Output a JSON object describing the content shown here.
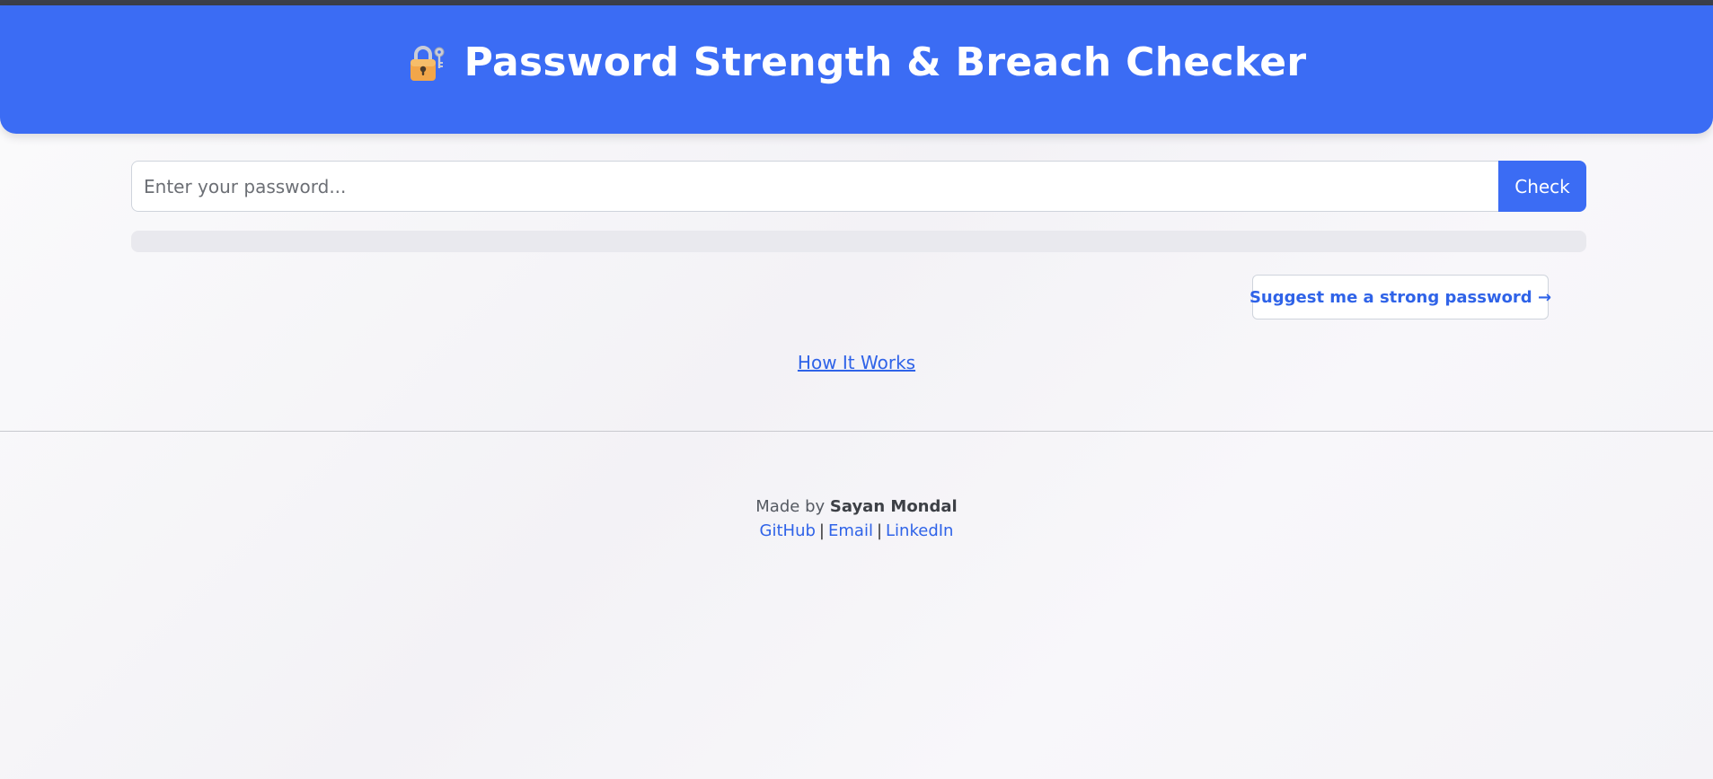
{
  "header": {
    "icon": "lock-with-key-icon",
    "title": "Password Strength & Breach Checker"
  },
  "password_form": {
    "placeholder": "Enter your password...",
    "value": "",
    "check_label": "Check"
  },
  "strength_meter": {
    "fill_percent": 0
  },
  "suggest": {
    "label": "Suggest me a strong password →"
  },
  "how_it_works": {
    "label": "How It Works"
  },
  "footer": {
    "made_by_prefix": "Made by",
    "author": "Sayan Mondal",
    "links": [
      "GitHub",
      "Email",
      "LinkedIn"
    ],
    "separator": "|"
  },
  "colors": {
    "accent": "#3b6cf4",
    "link": "#2f63e8"
  }
}
